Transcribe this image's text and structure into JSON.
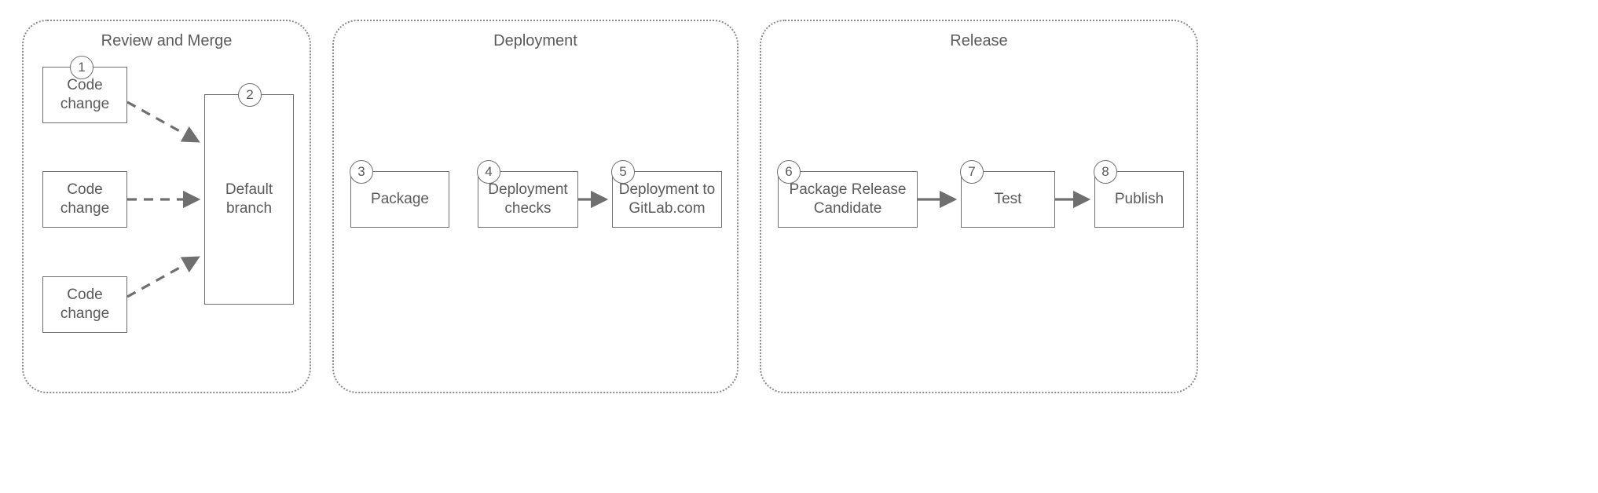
{
  "groups": {
    "review": {
      "title": "Review and Merge"
    },
    "deploy": {
      "title": "Deployment"
    },
    "release": {
      "title": "Release"
    }
  },
  "nodes": {
    "code1": {
      "label": "Code\nchange",
      "badge": "1"
    },
    "code2": {
      "label": "Code\nchange"
    },
    "code3": {
      "label": "Code\nchange"
    },
    "defbranch": {
      "label": "Default\nbranch",
      "badge": "2"
    },
    "package": {
      "label": "Package",
      "badge": "3"
    },
    "checks": {
      "label": "Deployment\nchecks",
      "badge": "4"
    },
    "deployto": {
      "label": "Deployment to\nGitLab.com",
      "badge": "5"
    },
    "prc": {
      "label": "Package Release\nCandidate",
      "badge": "6"
    },
    "test": {
      "label": "Test",
      "badge": "7"
    },
    "publish": {
      "label": "Publish",
      "badge": "8"
    }
  }
}
